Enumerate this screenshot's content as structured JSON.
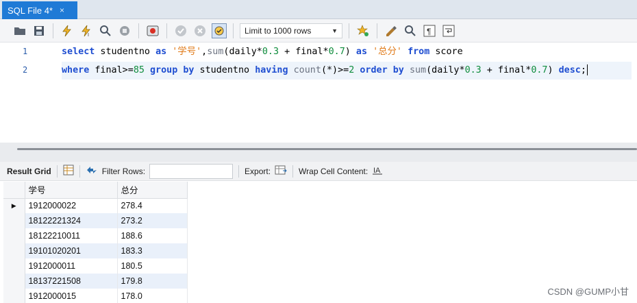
{
  "tab": {
    "title": "SQL File 4*",
    "close_glyph": "×"
  },
  "toolbar": {
    "limit_label": "Limit to 1000 rows",
    "icons": [
      "folder-open-icon",
      "save-icon",
      "execute-icon",
      "execute-current-icon",
      "explain-icon",
      "stop-icon",
      "toggle-error-icon",
      "commit-icon",
      "rollback-icon",
      "autocommit-icon",
      "bookmark-icon",
      "beautify-icon",
      "find-icon",
      "invisible-chars-icon",
      "wrap-icon"
    ]
  },
  "editor": {
    "line_numbers": [
      "1",
      "2"
    ],
    "line1": [
      {
        "t": "select",
        "k": "kw"
      },
      {
        "t": " studentno ",
        "k": ""
      },
      {
        "t": "as",
        "k": "kw"
      },
      {
        "t": " ",
        "k": ""
      },
      {
        "t": "'学号'",
        "k": "str"
      },
      {
        "t": ",",
        "k": ""
      },
      {
        "t": "sum",
        "k": "fn"
      },
      {
        "t": "(daily*",
        "k": ""
      },
      {
        "t": "0.3",
        "k": "num"
      },
      {
        "t": " + final*",
        "k": ""
      },
      {
        "t": "0.7",
        "k": "num"
      },
      {
        "t": ") ",
        "k": ""
      },
      {
        "t": "as",
        "k": "kw"
      },
      {
        "t": " ",
        "k": ""
      },
      {
        "t": "'总分'",
        "k": "str"
      },
      {
        "t": " ",
        "k": ""
      },
      {
        "t": "from",
        "k": "kw"
      },
      {
        "t": " score",
        "k": ""
      }
    ],
    "line2": [
      {
        "t": "where",
        "k": "kw"
      },
      {
        "t": " final>=",
        "k": ""
      },
      {
        "t": "85",
        "k": "num"
      },
      {
        "t": " ",
        "k": ""
      },
      {
        "t": "group by",
        "k": "kw"
      },
      {
        "t": " studentno ",
        "k": ""
      },
      {
        "t": "having",
        "k": "kw"
      },
      {
        "t": " ",
        "k": ""
      },
      {
        "t": "count",
        "k": "fn"
      },
      {
        "t": "(*)>=",
        "k": ""
      },
      {
        "t": "2",
        "k": "num"
      },
      {
        "t": " ",
        "k": ""
      },
      {
        "t": "order by",
        "k": "kw"
      },
      {
        "t": " ",
        "k": ""
      },
      {
        "t": "sum",
        "k": "fn"
      },
      {
        "t": "(daily*",
        "k": ""
      },
      {
        "t": "0.3",
        "k": "num"
      },
      {
        "t": " + final*",
        "k": ""
      },
      {
        "t": "0.7",
        "k": "num"
      },
      {
        "t": ") ",
        "k": ""
      },
      {
        "t": "desc",
        "k": "kw"
      },
      {
        "t": ";",
        "k": ""
      }
    ]
  },
  "results_toolbar": {
    "result_grid_label": "Result Grid",
    "filter_label": "Filter Rows:",
    "filter_value": "",
    "export_label": "Export:",
    "wrap_label": "Wrap Cell Content:"
  },
  "grid": {
    "columns": [
      "学号",
      "总分"
    ],
    "rows": [
      [
        "1912000022",
        "278.4"
      ],
      [
        "18122221324",
        "273.2"
      ],
      [
        "18122210011",
        "188.6"
      ],
      [
        "19101020201",
        "183.3"
      ],
      [
        "1912000011",
        "180.5"
      ],
      [
        "18137221508",
        "179.8"
      ],
      [
        "1912000015",
        "178.0"
      ]
    ],
    "selected_marker": "▶"
  },
  "watermark": "CSDN @GUMP小甘"
}
